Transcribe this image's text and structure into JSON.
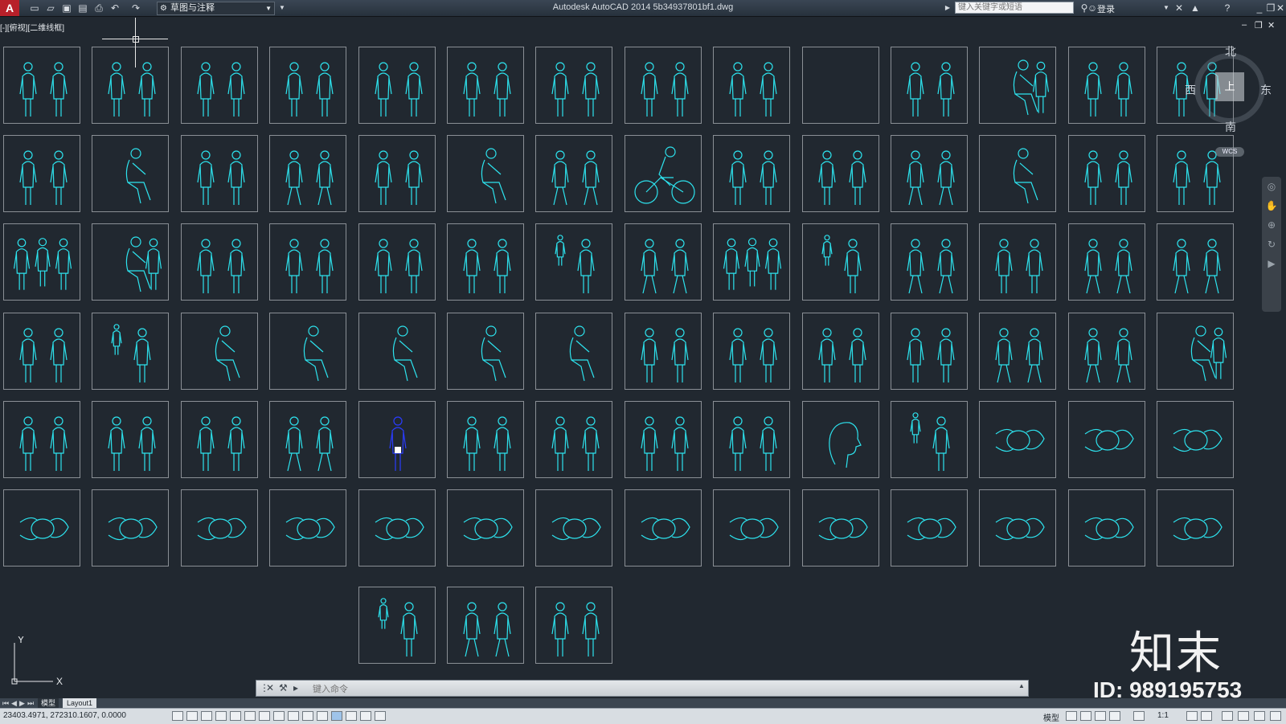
{
  "app": {
    "window_title": "Autodesk AutoCAD 2014    5b34937801bf1.dwg",
    "workspace": "草图与注释",
    "search_placeholder": "键入关键字或短语",
    "login_label": "登录"
  },
  "viewport": {
    "label": "[-][俯视][二维线框]"
  },
  "viewcube": {
    "north": "北",
    "south": "南",
    "east": "东",
    "west": "西",
    "face": "上",
    "wcs": "WCS"
  },
  "ucs": {
    "x_label": "X",
    "y_label": "Y"
  },
  "drawing": {
    "line_color": "#2de3ee",
    "selected_color": "#2a3cff",
    "frame_color": "#8a8f95",
    "blocks": [
      {
        "row": 1,
        "col": 1,
        "kind": "standing-pair"
      },
      {
        "row": 1,
        "col": 2,
        "kind": "standing-pair"
      },
      {
        "row": 1,
        "col": 3,
        "kind": "standing-pair"
      },
      {
        "row": 1,
        "col": 4,
        "kind": "standing-pair"
      },
      {
        "row": 1,
        "col": 5,
        "kind": "standing-pair"
      },
      {
        "row": 1,
        "col": 6,
        "kind": "standing-pair"
      },
      {
        "row": 1,
        "col": 7,
        "kind": "standing-pair"
      },
      {
        "row": 1,
        "col": 8,
        "kind": "standing-pair"
      },
      {
        "row": 1,
        "col": 9,
        "kind": "standing-pair"
      },
      {
        "row": 1,
        "col": 10,
        "kind": "empty"
      },
      {
        "row": 1,
        "col": 11,
        "kind": "standing-pair"
      },
      {
        "row": 1,
        "col": 12,
        "kind": "seated-pair"
      },
      {
        "row": 1,
        "col": 13,
        "kind": "standing-pair"
      },
      {
        "row": 1,
        "col": 14,
        "kind": "standing-pair"
      },
      {
        "row": 2,
        "col": 1,
        "kind": "standing-pair"
      },
      {
        "row": 2,
        "col": 2,
        "kind": "seated"
      },
      {
        "row": 2,
        "col": 3,
        "kind": "standing-pair"
      },
      {
        "row": 2,
        "col": 4,
        "kind": "walking-pair"
      },
      {
        "row": 2,
        "col": 5,
        "kind": "standing-pair"
      },
      {
        "row": 2,
        "col": 6,
        "kind": "reclining"
      },
      {
        "row": 2,
        "col": 7,
        "kind": "walking-pair"
      },
      {
        "row": 2,
        "col": 8,
        "kind": "cyclist"
      },
      {
        "row": 2,
        "col": 9,
        "kind": "standing-pair"
      },
      {
        "row": 2,
        "col": 10,
        "kind": "standing-pair"
      },
      {
        "row": 2,
        "col": 11,
        "kind": "walking-pair"
      },
      {
        "row": 2,
        "col": 12,
        "kind": "office-chair"
      },
      {
        "row": 2,
        "col": 13,
        "kind": "standing-pair"
      },
      {
        "row": 2,
        "col": 14,
        "kind": "standing-pair"
      },
      {
        "row": 3,
        "col": 1,
        "kind": "group"
      },
      {
        "row": 3,
        "col": 2,
        "kind": "seated-pair"
      },
      {
        "row": 3,
        "col": 3,
        "kind": "standing-pair"
      },
      {
        "row": 3,
        "col": 4,
        "kind": "couple"
      },
      {
        "row": 3,
        "col": 5,
        "kind": "couple"
      },
      {
        "row": 3,
        "col": 6,
        "kind": "couple"
      },
      {
        "row": 3,
        "col": 7,
        "kind": "stroller"
      },
      {
        "row": 3,
        "col": 8,
        "kind": "walking-pair"
      },
      {
        "row": 3,
        "col": 9,
        "kind": "family"
      },
      {
        "row": 3,
        "col": 10,
        "kind": "adult-child"
      },
      {
        "row": 3,
        "col": 11,
        "kind": "walking-pair"
      },
      {
        "row": 3,
        "col": 12,
        "kind": "standing-pair"
      },
      {
        "row": 3,
        "col": 13,
        "kind": "walking-pair"
      },
      {
        "row": 3,
        "col": 14,
        "kind": "walking-pair"
      },
      {
        "row": 4,
        "col": 1,
        "kind": "standing-pair"
      },
      {
        "row": 4,
        "col": 2,
        "kind": "pram"
      },
      {
        "row": 4,
        "col": 3,
        "kind": "seated"
      },
      {
        "row": 4,
        "col": 4,
        "kind": "armchair"
      },
      {
        "row": 4,
        "col": 5,
        "kind": "seated"
      },
      {
        "row": 4,
        "col": 6,
        "kind": "seated"
      },
      {
        "row": 4,
        "col": 7,
        "kind": "seated"
      },
      {
        "row": 4,
        "col": 8,
        "kind": "standing-pair"
      },
      {
        "row": 4,
        "col": 9,
        "kind": "standing-pair"
      },
      {
        "row": 4,
        "col": 10,
        "kind": "handshake"
      },
      {
        "row": 4,
        "col": 11,
        "kind": "standing-pair"
      },
      {
        "row": 4,
        "col": 12,
        "kind": "walking-pair"
      },
      {
        "row": 4,
        "col": 13,
        "kind": "walking-pair"
      },
      {
        "row": 4,
        "col": 14,
        "kind": "seated-pair"
      },
      {
        "row": 5,
        "col": 1,
        "kind": "standing-pair"
      },
      {
        "row": 5,
        "col": 2,
        "kind": "standing-pair"
      },
      {
        "row": 5,
        "col": 3,
        "kind": "standing-pair"
      },
      {
        "row": 5,
        "col": 4,
        "kind": "kids-ball"
      },
      {
        "row": 5,
        "col": 5,
        "kind": "selected-figure"
      },
      {
        "row": 5,
        "col": 6,
        "kind": "silhouette-pair"
      },
      {
        "row": 5,
        "col": 7,
        "kind": "silhouette-couple"
      },
      {
        "row": 5,
        "col": 8,
        "kind": "silhouette-pair"
      },
      {
        "row": 5,
        "col": 9,
        "kind": "silhouette-pair"
      },
      {
        "row": 5,
        "col": 10,
        "kind": "head-profile"
      },
      {
        "row": 5,
        "col": 11,
        "kind": "adult-child"
      },
      {
        "row": 5,
        "col": 12,
        "kind": "plan-view"
      },
      {
        "row": 5,
        "col": 13,
        "kind": "plan-view"
      },
      {
        "row": 5,
        "col": 14,
        "kind": "plan-view"
      },
      {
        "row": 6,
        "col": 1,
        "kind": "plan-view"
      },
      {
        "row": 6,
        "col": 2,
        "kind": "plan-view"
      },
      {
        "row": 6,
        "col": 3,
        "kind": "plan-view"
      },
      {
        "row": 6,
        "col": 4,
        "kind": "plan-view"
      },
      {
        "row": 6,
        "col": 5,
        "kind": "plan-view"
      },
      {
        "row": 6,
        "col": 6,
        "kind": "plan-view"
      },
      {
        "row": 6,
        "col": 7,
        "kind": "plan-view"
      },
      {
        "row": 6,
        "col": 8,
        "kind": "plan-view"
      },
      {
        "row": 6,
        "col": 9,
        "kind": "plan-view"
      },
      {
        "row": 6,
        "col": 10,
        "kind": "plan-view"
      },
      {
        "row": 6,
        "col": 11,
        "kind": "plan-view"
      },
      {
        "row": 6,
        "col": 12,
        "kind": "plan-view"
      },
      {
        "row": 6,
        "col": 13,
        "kind": "plan-view"
      },
      {
        "row": 6,
        "col": 14,
        "kind": "plan-view"
      },
      {
        "row": 7,
        "col": 5,
        "kind": "adult-child"
      },
      {
        "row": 7,
        "col": 6,
        "kind": "walking-pair"
      },
      {
        "row": 7,
        "col": 7,
        "kind": "couple"
      }
    ]
  },
  "watermark": {
    "brand": "知末",
    "id": "ID: 989195753"
  },
  "command_line": {
    "placeholder": "键入命令"
  },
  "tabs": {
    "model": "模型",
    "layout1": "Layout1"
  },
  "status_bar": {
    "coordinates": "23403.4971,   272310.1607,  0.0000",
    "model_label": "模型",
    "scale": "1:1"
  }
}
